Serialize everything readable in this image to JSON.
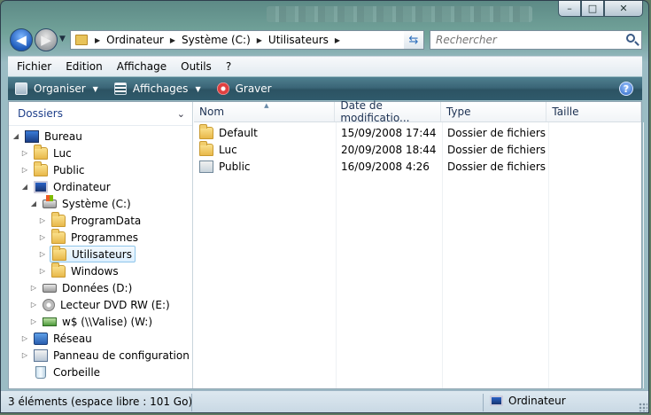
{
  "window": {
    "buttons": {
      "minimize": "–",
      "maximize": "□",
      "close": "✕"
    }
  },
  "navigation": {
    "back_icon": "back-arrow-icon",
    "forward_icon": "forward-arrow-icon",
    "address": {
      "segments": [
        "Ordinateur",
        "Système (C:)",
        "Utilisateurs"
      ]
    },
    "search": {
      "placeholder": "Rechercher"
    }
  },
  "menubar": {
    "items": [
      "Fichier",
      "Edition",
      "Affichage",
      "Outils",
      "?"
    ]
  },
  "toolbar": {
    "organiser": "Organiser",
    "affichages": "Affichages",
    "graver": "Graver",
    "help": "?"
  },
  "nav_pane": {
    "header": "Dossiers",
    "tree": [
      {
        "label": "Bureau",
        "icon": "desktop-icon"
      },
      {
        "label": "Luc",
        "icon": "folder-icon"
      },
      {
        "label": "Public",
        "icon": "folder-icon"
      },
      {
        "label": "Ordinateur",
        "icon": "computer-icon"
      },
      {
        "label": "Système (C:)",
        "icon": "system-drive-icon"
      },
      {
        "label": "ProgramData",
        "icon": "folder-icon"
      },
      {
        "label": "Programmes",
        "icon": "folder-icon"
      },
      {
        "label": "Utilisateurs",
        "icon": "folder-icon",
        "selected": true
      },
      {
        "label": "Windows",
        "icon": "folder-icon"
      },
      {
        "label": "Données (D:)",
        "icon": "drive-icon"
      },
      {
        "label": "Lecteur DVD RW (E:)",
        "icon": "dvd-drive-icon"
      },
      {
        "label": "w$ (\\\\Valise) (W:)",
        "icon": "network-drive-icon"
      },
      {
        "label": "Réseau",
        "icon": "network-icon"
      },
      {
        "label": "Panneau de configuration",
        "icon": "control-panel-icon"
      },
      {
        "label": "Corbeille",
        "icon": "recycle-bin-icon"
      }
    ]
  },
  "file_list": {
    "columns": [
      "Nom",
      "Date de modificatio...",
      "Type",
      "Taille"
    ],
    "rows": [
      {
        "name": "Default",
        "date": "15/09/2008 17:44",
        "type": "Dossier de fichiers",
        "size": "",
        "icon": "folder-icon"
      },
      {
        "name": "Luc",
        "date": "20/09/2008 18:44",
        "type": "Dossier de fichiers",
        "size": "",
        "icon": "folder-icon"
      },
      {
        "name": "Public",
        "date": "16/09/2008 4:26",
        "type": "Dossier de fichiers",
        "size": "",
        "icon": "public-folder-icon"
      }
    ]
  },
  "statusbar": {
    "left": "3 éléments (espace libre : 101 Go)",
    "right": "Ordinateur"
  }
}
